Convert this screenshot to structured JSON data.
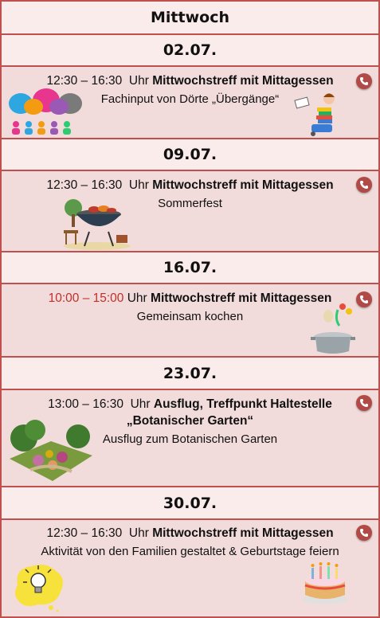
{
  "title": "Mittwoch",
  "events": [
    {
      "date": "02.07.",
      "time": "12:30 – 16:30",
      "uhr": "Uhr",
      "title": "Mittwochstreff mit Mittagessen",
      "desc": "Fachinput von Dörte „Übergänge“"
    },
    {
      "date": "09.07.",
      "time": "12:30 – 16:30",
      "uhr": "Uhr",
      "title": "Mittwochstreff mit Mittagessen",
      "desc": "Sommerfest"
    },
    {
      "date": "16.07.",
      "time": "10:00 – 15:00",
      "uhr": "Uhr",
      "title": "Mittwochstreff mit Mittagessen",
      "desc": "Gemeinsam kochen",
      "time_color": "#c0302a"
    },
    {
      "date": "23.07.",
      "time": "13:00 – 16:30",
      "uhr": "Uhr",
      "title": "Ausflug, Treffpunkt Haltestelle",
      "title2": "„Botanischer Garten“",
      "desc": "Ausflug zum Botanischen Garten"
    },
    {
      "date": "30.07.",
      "time": "12:30 – 16:30",
      "uhr": "Uhr",
      "title": "Mittwochstreff mit Mittagessen",
      "desc": "Aktivität von den Familien gestaltet & Geburtstage feiern"
    }
  ],
  "icons": [
    "phone-icon",
    "speech-bubbles-icon",
    "reading-child-icon",
    "barbecue-grill-icon",
    "cooking-pot-icon",
    "garden-icon",
    "lightbulb-icon",
    "birthday-cake-icon"
  ]
}
